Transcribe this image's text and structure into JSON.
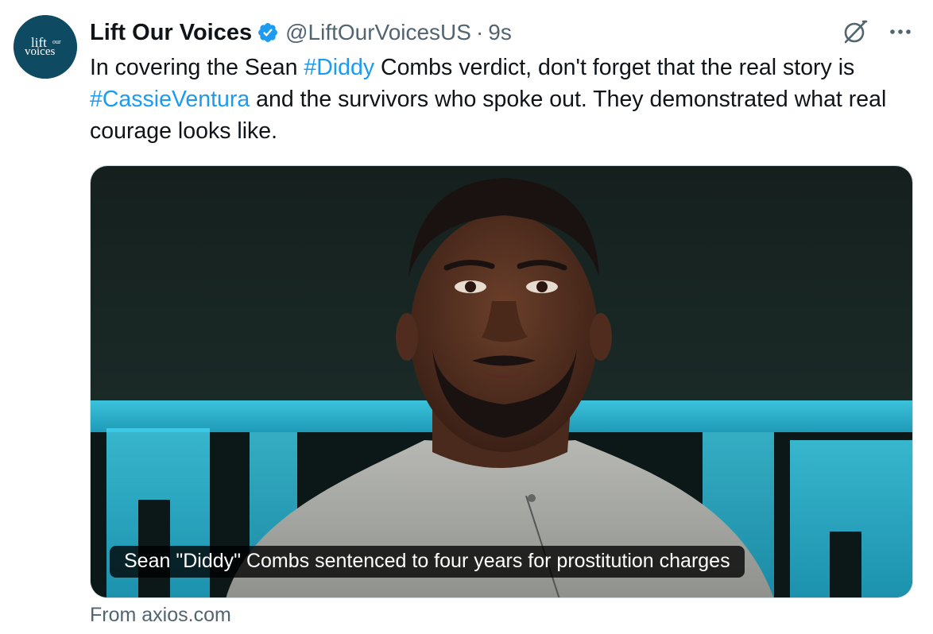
{
  "account": {
    "avatar_text_line1": "lift our",
    "avatar_text_line2": "voices",
    "display_name": "Lift Our Voices",
    "handle": "@LiftOurVoicesUS",
    "separator": "·",
    "timestamp": "9s",
    "verified_color": "#1d9bf0"
  },
  "actions": {
    "grok_icon": "grok-icon",
    "more_icon": "more-icon"
  },
  "tweet": {
    "text_1": "In covering the Sean ",
    "hashtag_1": "#Diddy",
    "text_2": " Combs verdict, don't forget that the real story is ",
    "hashtag_2": "#CassieVentura",
    "text_3": " and the survivors who spoke out. They demonstrated what real courage looks like."
  },
  "card": {
    "caption": "Sean \"Diddy\" Combs sentenced to four years for prostitution charges",
    "source": "From axios.com"
  },
  "colors": {
    "link": "#1d9bf0",
    "secondary": "#536471",
    "avatar_bg": "#0f4a63"
  }
}
